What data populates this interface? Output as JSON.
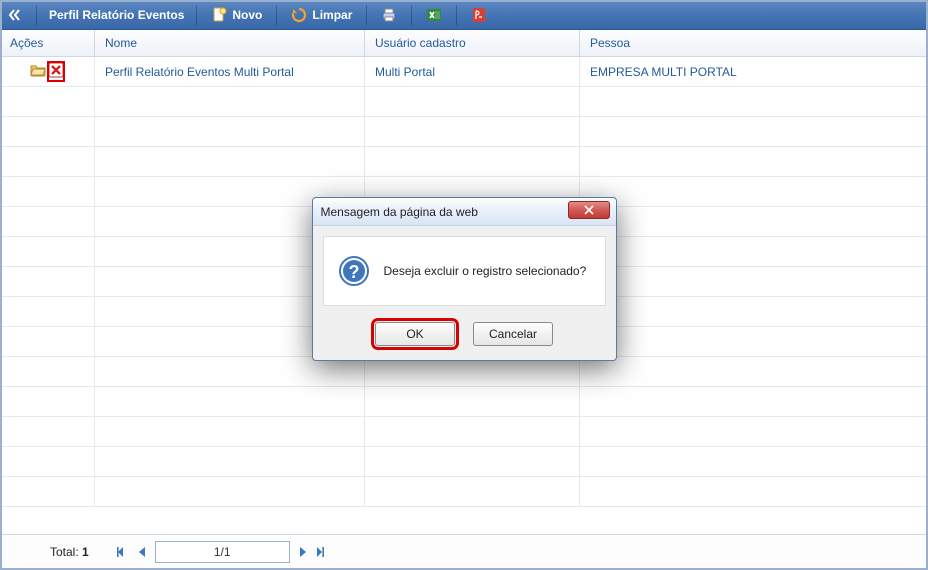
{
  "toolbar": {
    "title": "Perfil Relatório Eventos",
    "novo_label": "Novo",
    "limpar_label": "Limpar"
  },
  "grid": {
    "headers": {
      "acoes": "Ações",
      "nome": "Nome",
      "usuario": "Usuário cadastro",
      "pessoa": "Pessoa"
    },
    "rows": [
      {
        "nome": "Perfil Relatório Eventos Multi Portal",
        "usuario": "Multi Portal",
        "pessoa": "EMPRESA MULTI PORTAL"
      }
    ],
    "empty_row_count": 14
  },
  "footer": {
    "total_label": "Total:",
    "total_value": "1",
    "page": "1/1"
  },
  "dialog": {
    "title": "Mensagem da página da web",
    "message": "Deseja excluir o registro selecionado?",
    "ok_label": "OK",
    "cancel_label": "Cancelar"
  }
}
